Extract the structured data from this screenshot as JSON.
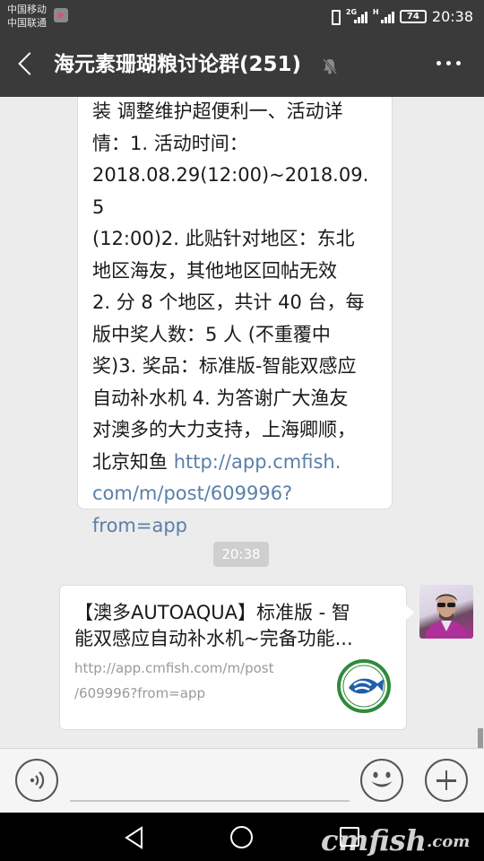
{
  "status_bar": {
    "carrier_1": "中国移动",
    "carrier_2": "中国联通",
    "network_1": "2G",
    "network_2": "H",
    "battery": "74",
    "time": "20:38"
  },
  "title_bar": {
    "title": "海元素珊瑚粮讨论群(251)",
    "muted": true
  },
  "messages": {
    "text_message": {
      "lines": [
        "装 调整维护超便利一、活动详",
        "情：1. 活动时间：",
        "2018.08.29(12:00)~2018.09.5",
        "(12:00)2. 此贴针对地区：东北",
        "地区海友，其他地区回帖无效",
        "2. 分 8 个地区，共计 40 台，每",
        "版中奖人数：5 人 (不重覆中",
        "奖)3. 奖品：标准版-智能双感应",
        "自动补水机 4. 为答谢广大渔友",
        "对澳多的大力支持，上海卿顺，"
      ],
      "last_line_prefix": "北京知鱼 ",
      "link_lines": [
        "http://app.cmfish.",
        "com/m/post/609996?",
        "from=app"
      ]
    },
    "timestamp": "20:38",
    "share_card": {
      "title_line_1": "【澳多AUTOAQUA】标准版 - 智",
      "title_line_2": "能双感应自动补水机~完备功能...",
      "url_line_1": "http://app.cmfish.com/m/post",
      "url_line_2": "/609996?from=app"
    }
  },
  "watermark": {
    "text": "cmfish",
    "suffix": ".com"
  },
  "colors": {
    "bar_dark": "#3a3a3a",
    "chat_bg": "#ececec",
    "link": "#5b7fa8"
  }
}
